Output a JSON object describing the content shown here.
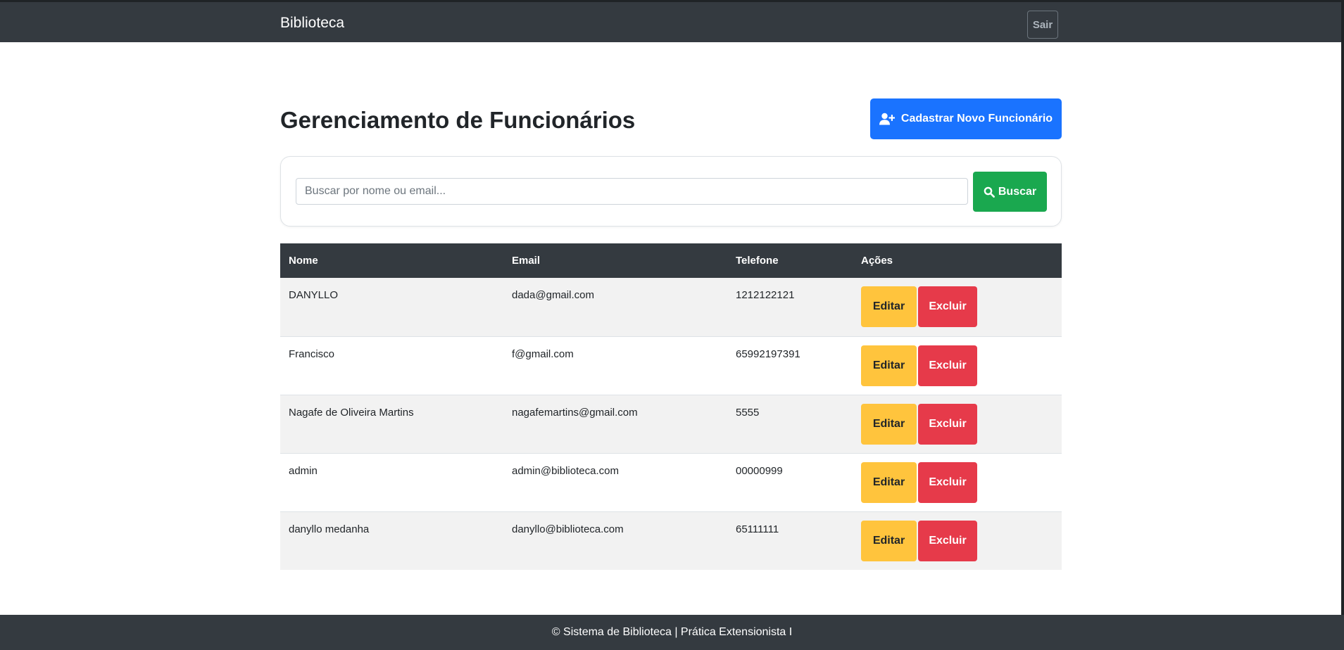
{
  "navbar": {
    "brand": "Biblioteca",
    "logout_label": "Sair"
  },
  "header": {
    "title": "Gerenciamento de Funcionários",
    "new_button_label": "Cadastrar Novo Funcionário",
    "new_button_icon": "user-plus-icon"
  },
  "search": {
    "placeholder": "Buscar por nome ou email...",
    "value": "",
    "button_label": "Buscar",
    "button_icon": "search-icon"
  },
  "table": {
    "columns": [
      "Nome",
      "Email",
      "Telefone",
      "Ações"
    ],
    "rows": [
      {
        "name": "DANYLLO",
        "email": "dada@gmail.com",
        "phone": "1212122121"
      },
      {
        "name": "Francisco",
        "email": "f@gmail.com",
        "phone": "65992197391"
      },
      {
        "name": "Nagafe de Oliveira Martins",
        "email": "nagafemartins@gmail.com",
        "phone": "5555"
      },
      {
        "name": "admin",
        "email": "admin@biblioteca.com",
        "phone": "00000999"
      },
      {
        "name": "danyllo medanha",
        "email": "danyllo@biblioteca.com",
        "phone": "65111111"
      }
    ],
    "edit_label": "Editar",
    "delete_label": "Excluir"
  },
  "footer": {
    "text": "© Sistema de Biblioteca | Prática Extensionista I"
  },
  "colors": {
    "navbar": "#343a40",
    "primary": "#1a73ff",
    "success": "#1aa84f",
    "warning": "#ffc43d",
    "danger": "#e63a4a"
  }
}
